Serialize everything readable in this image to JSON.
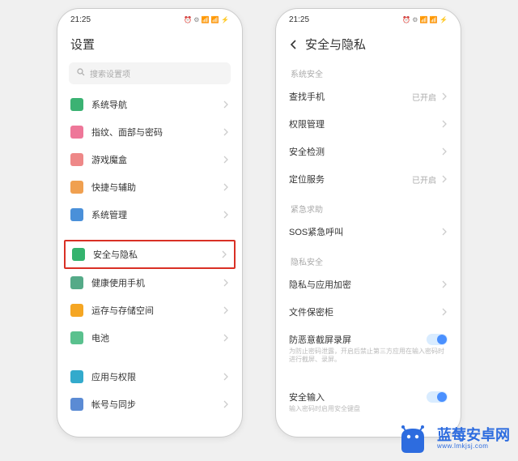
{
  "statusbar": {
    "time": "21:25",
    "icons": "⏰ ⚙ 📶 📶 ⚡"
  },
  "left": {
    "title": "设置",
    "search_placeholder": "搜索设置项",
    "items": [
      {
        "label": "系统导航"
      },
      {
        "label": "指纹、面部与密码"
      },
      {
        "label": "游戏魔盒"
      },
      {
        "label": "快捷与辅助"
      },
      {
        "label": "系统管理"
      },
      {
        "label": "安全与隐私"
      },
      {
        "label": "健康使用手机"
      },
      {
        "label": "运存与存储空间"
      },
      {
        "label": "电池"
      },
      {
        "label": "应用与权限"
      },
      {
        "label": "帐号与同步"
      }
    ]
  },
  "right": {
    "title": "安全与隐私",
    "sections": {
      "system": "系统安全",
      "emergency": "紧急求助",
      "privacy": "隐私安全"
    },
    "find_phone": {
      "label": "查找手机",
      "value": "已开启"
    },
    "perm": {
      "label": "权限管理"
    },
    "check": {
      "label": "安全检测"
    },
    "location": {
      "label": "定位服务",
      "value": "已开启"
    },
    "sos": {
      "label": "SOS紧急呼叫"
    },
    "app_enc": {
      "label": "隐私与应用加密"
    },
    "vault": {
      "label": "文件保密柜"
    },
    "anti_screenshot": {
      "label": "防恶意截屏录屏",
      "desc": "为防止密码泄露，开启后禁止第三方应用在输入密码时进行截屏、录屏。"
    },
    "secure_input": {
      "label": "安全输入",
      "desc": "输入密码时启用安全键盘"
    }
  },
  "watermark": {
    "text": "蓝莓安卓网",
    "url": "www.lmkjsj.com"
  }
}
